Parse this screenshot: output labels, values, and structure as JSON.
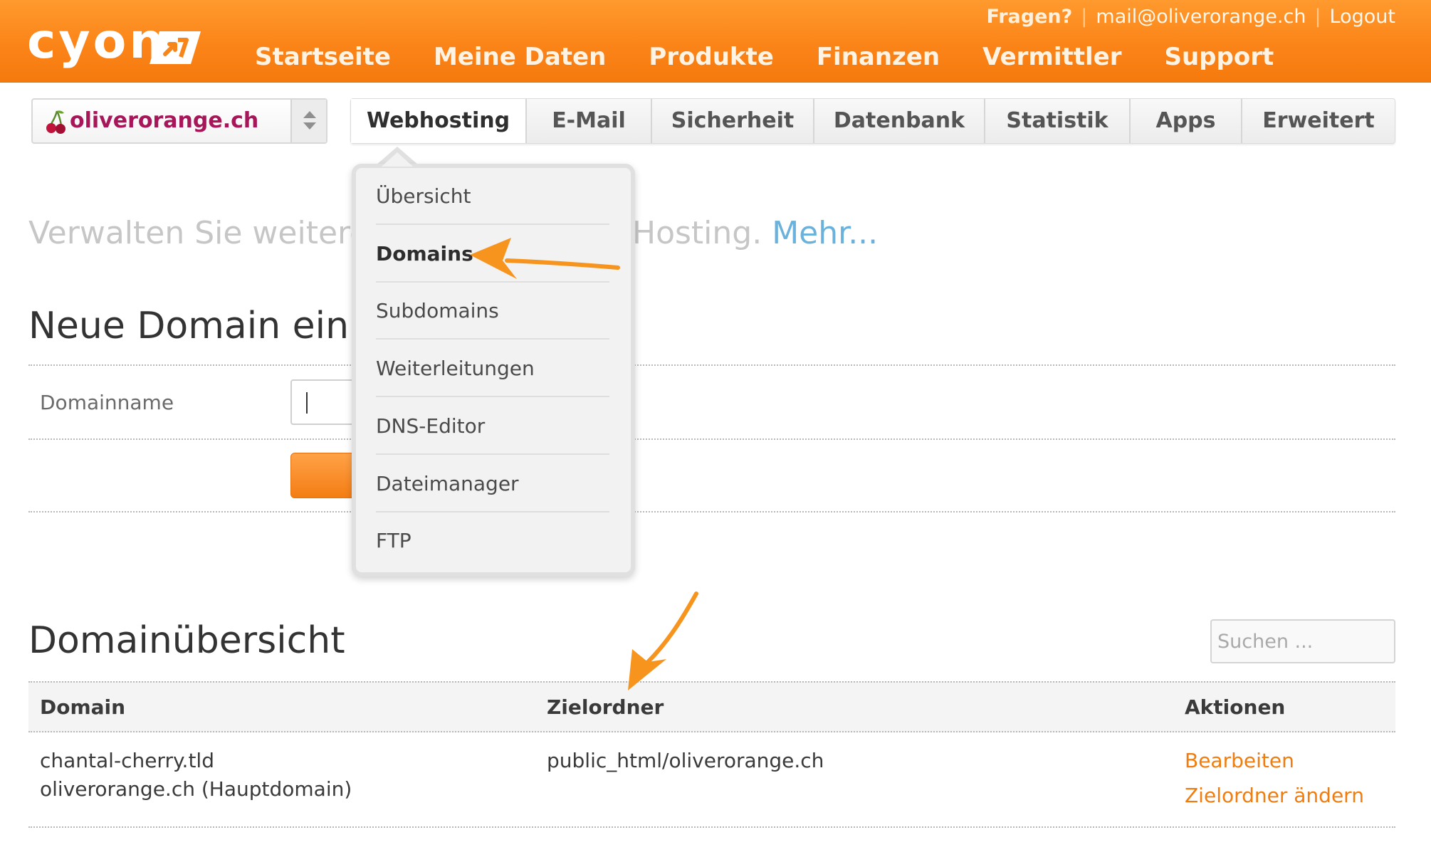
{
  "header": {
    "logo_text": "cyon",
    "top_links": {
      "help": "Fragen?",
      "email": "mail@oliverorange.ch",
      "logout": "Logout"
    },
    "nav": [
      "Startseite",
      "Meine Daten",
      "Produkte",
      "Finanzen",
      "Vermittler",
      "Support"
    ]
  },
  "domain_selector": {
    "value": "oliverorange.ch"
  },
  "tabs": [
    "Webhosting",
    "E-Mail",
    "Sicherheit",
    "Datenbank",
    "Statistik",
    "Apps",
    "Erweitert"
  ],
  "dropdown": [
    "Übersicht",
    "Domains",
    "Subdomains",
    "Weiterleitungen",
    "DNS-Editor",
    "Dateimanager",
    "FTP"
  ],
  "promo": {
    "text": "Verwalten Sie weitere",
    "text_right": "Hosting.",
    "more": "Mehr..."
  },
  "new_domain": {
    "title": "Neue Domain einric",
    "label": "Domainname"
  },
  "overview": {
    "title": "Domainübersicht",
    "search_placeholder": "Suchen ...",
    "columns": [
      "Domain",
      "Zielordner",
      "Aktionen"
    ],
    "row": {
      "domains": [
        "chantal-cherry.tld",
        "oliverorange.ch (Hauptdomain)"
      ],
      "folder": "public_html/oliverorange.ch",
      "actions": [
        "Bearbeiten",
        "Zielordner ändern"
      ]
    }
  },
  "colors": {
    "brand_orange": "#f57a0e",
    "link_orange": "#f07d0e",
    "domain_magenta": "#a8165a",
    "more_blue": "#6ab2dc",
    "arrow_orange": "#f7941d"
  },
  "icons": [
    "cyon-logo-icon",
    "cherry-icon",
    "select-arrows-icon",
    "annotation-arrow-icon"
  ]
}
